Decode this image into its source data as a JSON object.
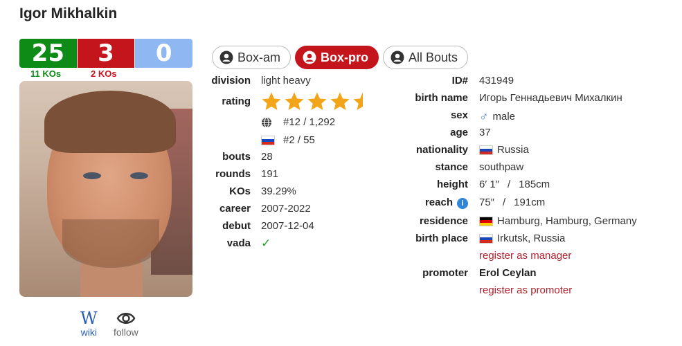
{
  "boxer": {
    "name": "Igor Mikhalkin"
  },
  "record": {
    "wins": "25",
    "losses": "3",
    "draws": "0",
    "win_kos": "11 KOs",
    "loss_kos": "2 KOs",
    "colors": {
      "win": "#0e8a16",
      "loss": "#c4151c",
      "draw": "#8fb8f2"
    }
  },
  "links": {
    "wiki": "wiki",
    "follow": "follow"
  },
  "tabs": [
    {
      "label": "Box-am",
      "active": false
    },
    {
      "label": "Box-pro",
      "active": true
    },
    {
      "label": "All Bouts",
      "active": false
    }
  ],
  "left": {
    "division_label": "division",
    "division": "light heavy",
    "rating_label": "rating",
    "rating_stars": 4.5,
    "rating_stars_max": 5,
    "world_rank": "#12 / 1,292",
    "national_rank": "#2 / 55",
    "bouts_label": "bouts",
    "bouts": "28",
    "rounds_label": "rounds",
    "rounds": "191",
    "kos_label": "KOs",
    "kos": "39.29%",
    "career_label": "career",
    "career": "2007-2022",
    "debut_label": "debut",
    "debut": "2007-12-04",
    "vada_label": "vada"
  },
  "right": {
    "id_label": "ID#",
    "id": "431949",
    "birth_name_label": "birth name",
    "birth_name": "Игорь Геннадьевич Михалкин",
    "sex_label": "sex",
    "sex": "male",
    "age_label": "age",
    "age": "37",
    "nationality_label": "nationality",
    "nationality": "Russia",
    "stance_label": "stance",
    "stance": "southpaw",
    "height_label": "height",
    "height_imperial": "6′ 1″",
    "height_sep": "/",
    "height_metric": "185cm",
    "reach_label": "reach",
    "reach_imperial": "75″",
    "reach_sep": "/",
    "reach_metric": "191cm",
    "residence_label": "residence",
    "residence": "Hamburg, Hamburg, Germany",
    "birth_place_label": "birth place",
    "birth_place": "Irkutsk, Russia",
    "register_manager": "register as manager",
    "promoter_label": "promoter",
    "promoter": "Erol Ceylan",
    "register_promoter": "register as promoter"
  },
  "icons": {
    "info": "i",
    "male": "♂",
    "check": "✓",
    "wiki": "W"
  },
  "colors": {
    "star": "#f3a519",
    "accent_red": "#c4151c",
    "link_red": "#b0212c"
  }
}
